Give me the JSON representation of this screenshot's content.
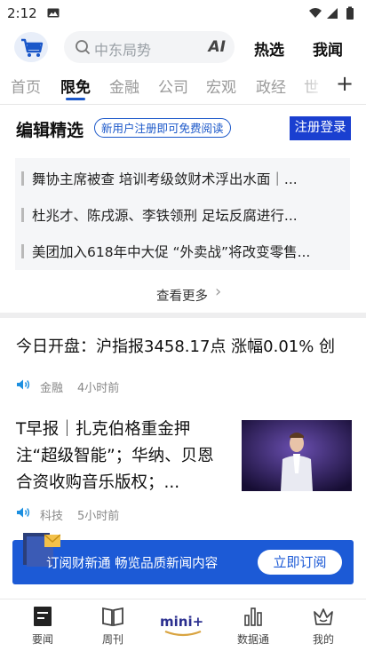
{
  "status": {
    "time": "2:12"
  },
  "search": {
    "placeholder": "中东局势",
    "ai_label": "AI",
    "hot_label": "热选",
    "ask_label": "我闻"
  },
  "tabs": [
    {
      "label": "首页"
    },
    {
      "label": "限免"
    },
    {
      "label": "金融"
    },
    {
      "label": "公司"
    },
    {
      "label": "宏观"
    },
    {
      "label": "政经"
    },
    {
      "label": "世"
    }
  ],
  "editor": {
    "title": "编辑精选",
    "badge": "新用户注册即可免费阅读",
    "register": "注册登录",
    "picks": [
      "舞协主席被查 培训考级敛财术浮出水面｜...",
      "杜兆才、陈戌源、李铁领刑 足坛反腐进行...",
      "美团加入618年中大促 “外卖战”将改变零售..."
    ],
    "more": "查看更多"
  },
  "articles": [
    {
      "title": "今日开盘：沪指报3458.17点 涨幅0.01% 创",
      "tag": "金融",
      "time": "4小时前"
    },
    {
      "title": "T早报｜扎克伯格重金押注“超级智能”；华纳、贝恩合资收购音乐版权；...",
      "tag": "科技",
      "time": "5小时前"
    }
  ],
  "banner": {
    "text": "订阅财新通 畅览品质新闻内容",
    "button": "立即订阅"
  },
  "bottom_nav": [
    {
      "label": "要闻"
    },
    {
      "label": "周刊"
    },
    {
      "label": "mini+"
    },
    {
      "label": "数据通"
    },
    {
      "label": "我的"
    }
  ],
  "colors": {
    "accent": "#1a57c9",
    "register": "#1a3fd0",
    "banner": "#1c5ad6"
  }
}
